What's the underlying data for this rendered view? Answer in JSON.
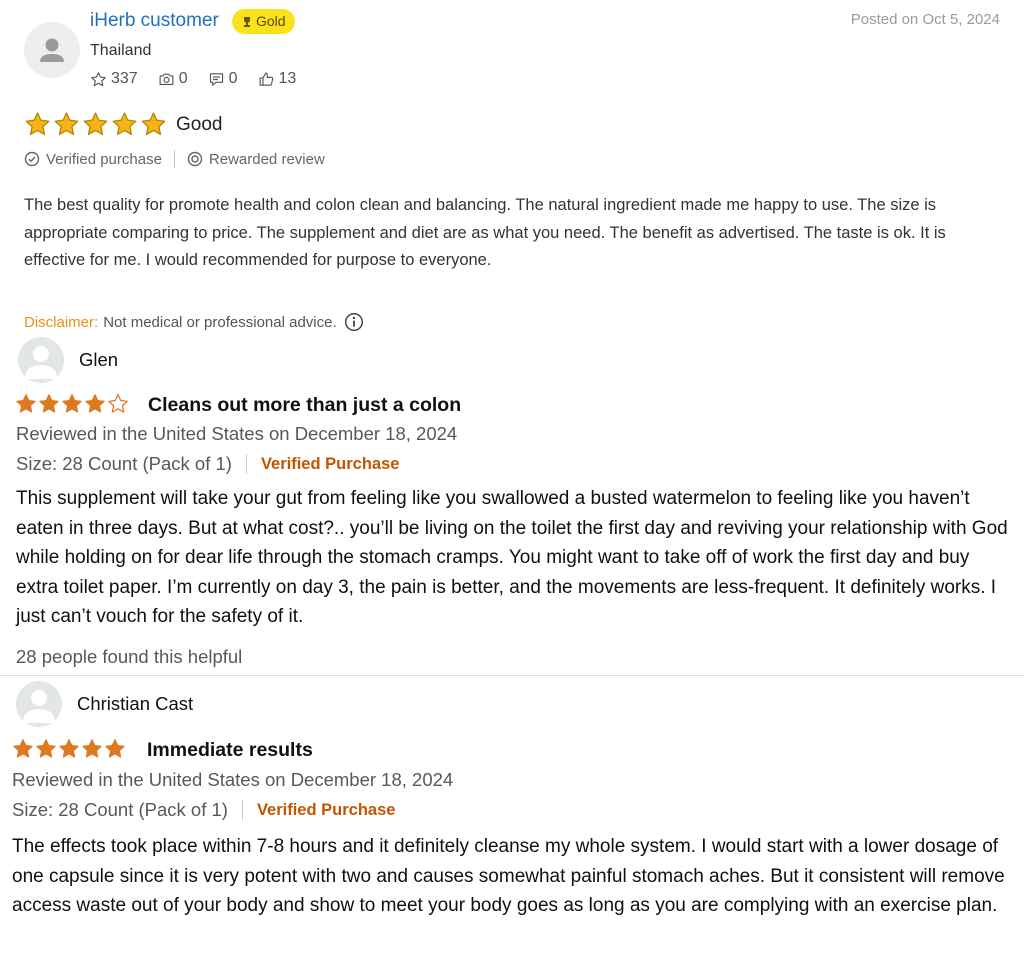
{
  "review1": {
    "reviewer_name": "iHerb customer",
    "badge": "Gold",
    "posted": "Posted on Oct 5, 2024",
    "country": "Thailand",
    "stats": {
      "reviews": "337",
      "photos": "0",
      "comments": "0",
      "helpful": "13"
    },
    "rating": 5,
    "rating_label": "Good",
    "verified_label": "Verified purchase",
    "rewarded_label": "Rewarded review",
    "body": "The best quality for promote health and colon clean and balancing. The natural ingredient made me happy to use. The size is appropriate comparing to price. The supplement and diet are as what you need. The benefit as advertised. The taste is ok. It is effective for me. I would recommended for purpose to everyone.",
    "disclaimer_label": "Disclaimer:",
    "disclaimer_text": "Not medical or professional advice.",
    "colors": {
      "link": "#1f6fc5",
      "badge": "#f9e21c",
      "star": "#f5b517",
      "disclaimer": "#e8920f"
    }
  },
  "review2": {
    "reviewer_name": "Glen",
    "rating": 4,
    "title": "Cleans out more than just a colon",
    "reviewed": "Reviewed in the United States on December 18, 2024",
    "size": "Size: 28 Count (Pack of 1)",
    "verified": "Verified Purchase",
    "body": "This supplement will take your gut from feeling like you swallowed a busted watermelon to feeling like you haven’t eaten in three days. But at what cost?.. you’ll be living on the toilet the first day and reviving your relationship with God while holding on for dear life through the stomach cramps. You might want to take off of work the first day and buy extra toilet paper. I’m currently on day 3, the pain is better, and the movements are less-frequent. It definitely works. I just can’t vouch for the safety of it.",
    "helpful": "28 people found this helpful"
  },
  "review3": {
    "reviewer_name": "Christian Cast",
    "rating": 5,
    "title": "Immediate results",
    "reviewed": "Reviewed in the United States on December 18, 2024",
    "size": "Size: 28 Count (Pack of 1)",
    "verified": "Verified Purchase",
    "body": "The effects took place within 7-8 hours and it definitely cleanse my whole system. I would start with a lower dosage of one capsule since it is very potent with two and causes somewhat painful stomach aches. But it consistent will remove access waste out of your body and show to meet your body goes as long as you are complying with an exercise plan."
  },
  "amazon_colors": {
    "star": "#de7921",
    "verified": "#c45500"
  }
}
